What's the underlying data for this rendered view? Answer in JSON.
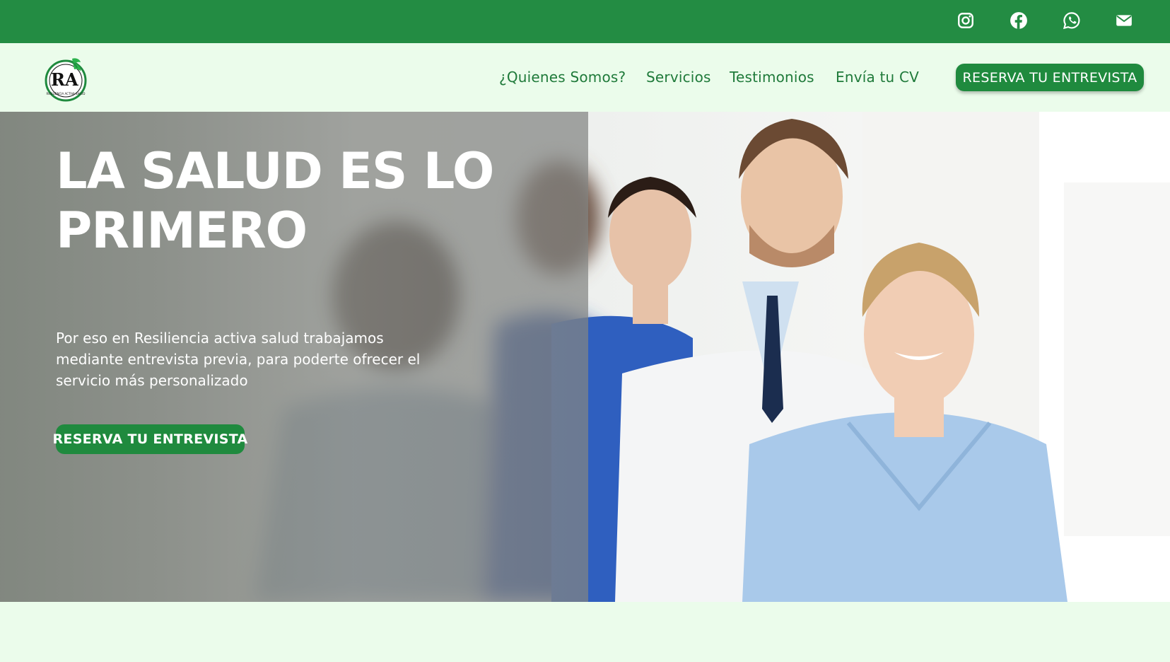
{
  "colors": {
    "brand_green": "#238c43",
    "button_green": "#1f8a3e",
    "nav_text": "#1f7a3a",
    "page_background": "#ebfceb"
  },
  "topbar": {
    "social_icons": [
      "instagram-icon",
      "facebook-icon",
      "whatsapp-icon",
      "mail-icon"
    ]
  },
  "header": {
    "logo": {
      "monogram": "RA",
      "ring_text": "RESILIENCIA ACTIVA SALUD"
    },
    "nav": [
      "¿Quienes Somos?",
      "Servicios",
      "Testimonios",
      "Envía tu CV"
    ],
    "cta_label": "RESERVA TU ENTREVISTA"
  },
  "hero": {
    "title_line1": "LA SALUD ES LO",
    "title_line2": "PRIMERO",
    "description": "Por eso en Resiliencia activa salud trabajamos mediante entrevista previa, para poderte ofrecer el servicio más personalizado",
    "cta_label": "RESERVA TU ENTREVISTA"
  }
}
